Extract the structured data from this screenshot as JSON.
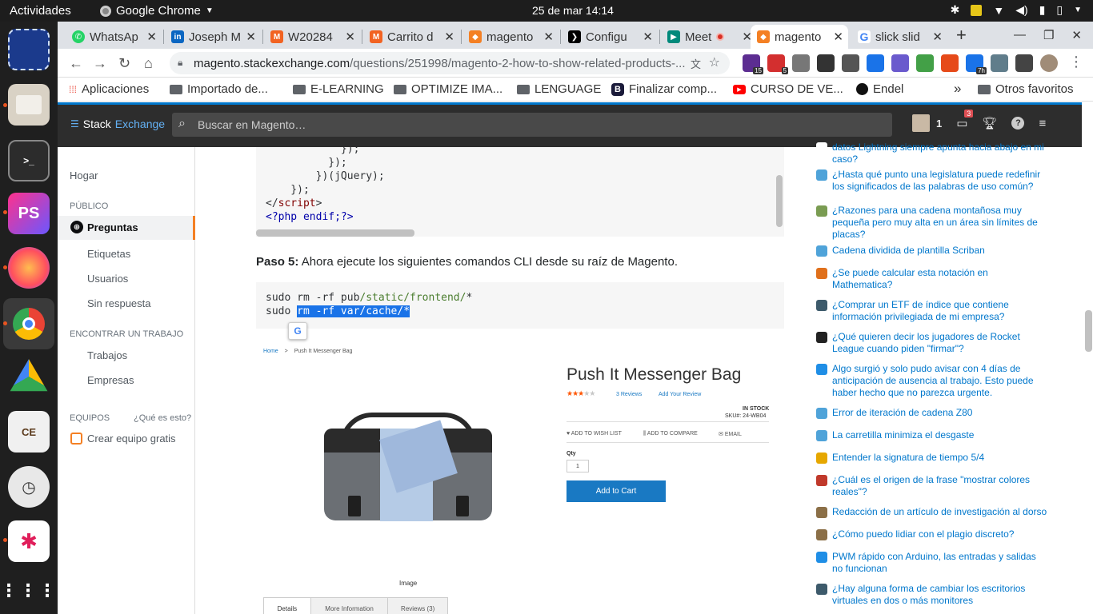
{
  "topbar": {
    "activities": "Actividades",
    "app_name": "Google Chrome",
    "datetime": "25 de mar  14:14"
  },
  "tabs": [
    {
      "label": "WhatsAp",
      "icon": "whatsapp-icon",
      "color": "#25d366"
    },
    {
      "label": "Joseph M",
      "icon": "linkedin-icon",
      "color": "#0a66c2"
    },
    {
      "label": "W20284",
      "icon": "magento-icon",
      "color": "#f26322"
    },
    {
      "label": "Carrito d",
      "icon": "magento-icon",
      "color": "#f26322"
    },
    {
      "label": "magento",
      "icon": "stackexchange-magento-icon",
      "color": "#f48024"
    },
    {
      "label": "Configu",
      "icon": "cursor-icon",
      "color": "#000000"
    },
    {
      "label": "Meet",
      "icon": "meet-icon",
      "color": "#00897b"
    },
    {
      "label": "magento",
      "icon": "stackexchange-magento-icon",
      "color": "#f48024"
    },
    {
      "label": "slick slid",
      "icon": "google-icon",
      "color": "#4285f4"
    }
  ],
  "omnibox": {
    "host": "magento.stackexchange.com",
    "path": "/questions/251998/magento-2-how-to-show-related-products-..."
  },
  "extensions": [
    {
      "badge": "15",
      "color": "#5c2d91"
    },
    {
      "badge": "5",
      "color": "#d32f2f"
    },
    {
      "badge": "",
      "color": "#777777"
    },
    {
      "badge": "",
      "color": "#333333"
    },
    {
      "badge": "",
      "color": "#555555"
    },
    {
      "badge": "",
      "color": "#1a73e8"
    },
    {
      "badge": "",
      "color": "#6a5acd"
    },
    {
      "badge": "",
      "color": "#43a047"
    },
    {
      "badge": "",
      "color": "#e64a19"
    },
    {
      "badge": "7h",
      "color": "#1a73e8"
    },
    {
      "badge": "",
      "color": "#607d8b"
    },
    {
      "badge": "",
      "color": "#444444"
    }
  ],
  "bookmarks": [
    {
      "label": "Aplicaciones",
      "icon": "apps-grid-icon"
    },
    {
      "label": "Importado de...",
      "icon": "folder-icon"
    },
    {
      "label": "E-LEARNING",
      "icon": "folder-icon"
    },
    {
      "label": "OPTIMIZE IMA...",
      "icon": "folder-icon"
    },
    {
      "label": "LENGUAGE",
      "icon": "folder-icon"
    },
    {
      "label": "Finalizar comp...",
      "icon": "bootstrap-icon"
    },
    {
      "label": "CURSO DE VE...",
      "icon": "youtube-icon"
    },
    {
      "label": "Endel",
      "icon": "endel-icon"
    },
    {
      "label": "Otros favoritos",
      "icon": "folder-icon"
    }
  ],
  "se": {
    "logo_a": "Stack",
    "logo_b": "Exchange",
    "search_placeholder": "Buscar en Magento…",
    "reputation": "1",
    "inbox_count": "3"
  },
  "leftnav": {
    "home": "Hogar",
    "public": "PÚBLICO",
    "questions": "Preguntas",
    "tags": "Etiquetas",
    "users": "Usuarios",
    "unanswered": "Sin respuesta",
    "jobs_header": "ENCONTRAR UN TRABAJO",
    "jobs": "Trabajos",
    "companies": "Empresas",
    "teams": "EQUIPOS",
    "whats_this": "¿Qué es esto?",
    "create_team": "Crear equipo gratis"
  },
  "code1": {
    "l1": "            });",
    "l2": "          });",
    "l3": "        })(jQuery);",
    "l4": "    });",
    "l5a": "</",
    "l5b": "script",
    "l5c": ">",
    "l6": "<?php endif;?>"
  },
  "step": {
    "bold": "Paso 5:",
    "text": " Ahora ejecute los siguientes comandos CLI desde su raíz de Magento."
  },
  "code2": {
    "l1a": "sudo rm -rf pub",
    "l1b": "/static/frontend/",
    "l1c": "*",
    "l2a": "sudo ",
    "l2b": "rm -rf var/cache/*"
  },
  "product": {
    "breadcrumb_home": "Home",
    "breadcrumb_sep": ">",
    "breadcrumb_item": "Push It Messenger Bag",
    "title": "Push It Messenger Bag",
    "rating": 3,
    "rating_max": 5,
    "reviews": "3  Reviews",
    "add_review": "Add Your Review",
    "stock": "IN STOCK",
    "sku": "SKU#:   24-WB04",
    "wishlist": "ADD TO WISH LIST",
    "compare": "ADD TO COMPARE",
    "email": "EMAIL",
    "qty_label": "Qty",
    "qty_value": "1",
    "add_to_cart": "Add to Cart",
    "image_caption": "Image",
    "tab_details": "Details",
    "tab_more": "More Information",
    "tab_reviews": "Reviews (3)"
  },
  "hot": [
    {
      "text": "datos Lightning siempre apunta hacia abajo en mi caso?",
      "color": "#ffffff"
    },
    {
      "text": "¿Hasta qué punto una legislatura puede redefinir los significados de las palabras de uso común?",
      "color": "#4fa3d9"
    },
    {
      "text": "¿Razones para una cadena montañosa muy pequeña pero muy alta en un área sin límites de placas?",
      "color": "#7a9c52"
    },
    {
      "text": "Cadena dividida de plantilla Scriban",
      "color": "#4fa3d9"
    },
    {
      "text": "¿Se puede calcular esta notación en Mathematica?",
      "color": "#e0701b"
    },
    {
      "text": "¿Comprar un ETF de índice que contiene información privilegiada de mi empresa?",
      "color": "#3d5a6b"
    },
    {
      "text": "¿Qué quieren decir los jugadores de Rocket League cuando piden \"firmar\"?",
      "color": "#222222"
    },
    {
      "text": "Algo surgió y solo pudo avisar con 4 días de anticipación de ausencia al trabajo. Esto puede haber hecho que no parezca urgente.",
      "color": "#1f8ee6"
    },
    {
      "text": "Error de iteración de cadena Z80",
      "color": "#4fa3d9"
    },
    {
      "text": "La carretilla minimiza el desgaste",
      "color": "#4fa3d9"
    },
    {
      "text": "Entender la signatura de tiempo 5/4",
      "color": "#e6a700"
    },
    {
      "text": "¿Cuál es el origen de la frase \"mostrar colores reales\"?",
      "color": "#c0392b"
    },
    {
      "text": "Redacción de un artículo de investigación al dorso",
      "color": "#8b6f47"
    },
    {
      "text": "¿Cómo puedo lidiar con el plagio discreto?",
      "color": "#8b6f47"
    },
    {
      "text": "PWM rápido con Arduino, las entradas y salidas no funcionan",
      "color": "#1f8ee6"
    },
    {
      "text": "¿Hay alguna forma de cambiar los escritorios virtuales en dos o más monitores",
      "color": "#3d5a6b"
    }
  ]
}
